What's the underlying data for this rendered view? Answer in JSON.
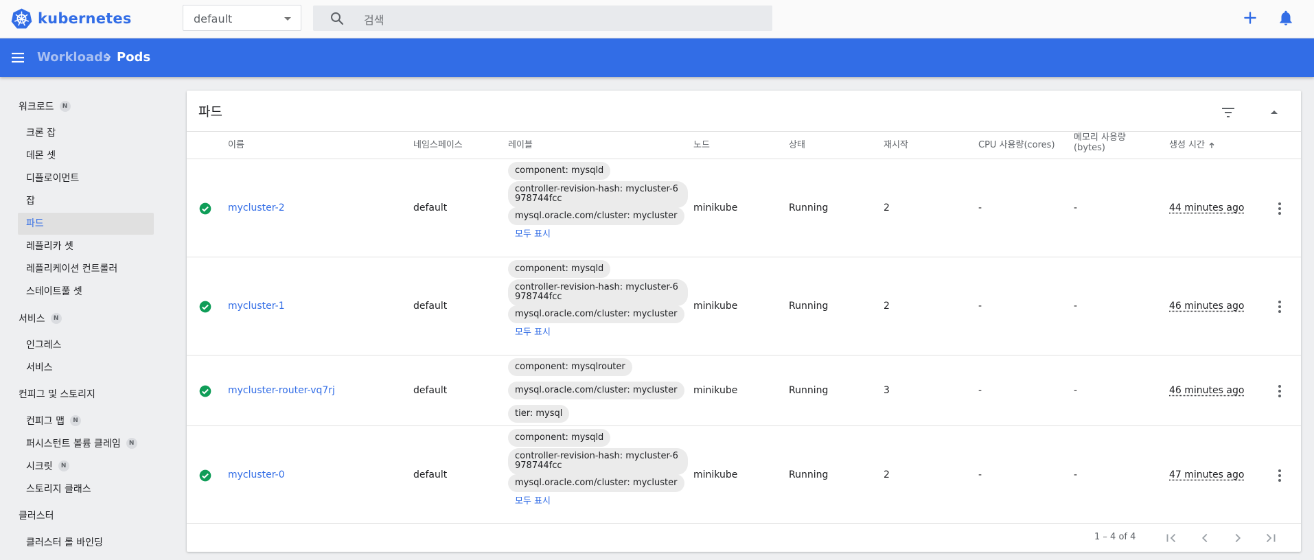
{
  "app": {
    "brand": "kubernetes",
    "accent": "#326de6"
  },
  "topbar": {
    "namespace": "default",
    "search_placeholder": "검색"
  },
  "breadcrumb": {
    "parent": "Workloads",
    "current": "Pods"
  },
  "sidebar": {
    "workloads": {
      "label": "워크로드",
      "badge": "N"
    },
    "workload_items": [
      "크론 잡",
      "데몬 셋",
      "디플로이먼트",
      "잡",
      "파드",
      "레플리카 셋",
      "레플리케이션 컨트롤러",
      "스테이트풀 셋"
    ],
    "services": {
      "label": "서비스",
      "badge": "N"
    },
    "service_items": [
      "인그레스",
      "서비스"
    ],
    "config": {
      "label": "컨피그 및 스토리지"
    },
    "config_items": [
      {
        "label": "컨피그 맵",
        "badge": "N"
      },
      {
        "label": "퍼시스턴트 볼륨 클레임",
        "badge": "N"
      },
      {
        "label": "시크릿",
        "badge": "N"
      },
      {
        "label": "스토리지 클래스"
      }
    ],
    "cluster": {
      "label": "클러스터"
    },
    "cluster_items": [
      "클러스터 롤 바인딩"
    ]
  },
  "card": {
    "title": "파드",
    "columns": {
      "name": "이름",
      "namespace": "네임스페이스",
      "labels": "레이블",
      "node": "노드",
      "status": "상태",
      "restarts": "재시작",
      "cpu": "CPU 사용량(cores)",
      "memory": "메모리 사용량 (bytes)",
      "created": "생성 시간"
    },
    "show_all": "모두 표시",
    "rows": [
      {
        "name": "mycluster-2",
        "namespace": "default",
        "labels": [
          "component: mysqld",
          "controller-revision-hash: mycluster-6978744fcc",
          "mysql.oracle.com/cluster: mycluster"
        ],
        "node": "minikube",
        "status": "Running",
        "restarts": "2",
        "cpu": "-",
        "memory": "-",
        "created": "44 minutes ago"
      },
      {
        "name": "mycluster-1",
        "namespace": "default",
        "labels": [
          "component: mysqld",
          "controller-revision-hash: mycluster-6978744fcc",
          "mysql.oracle.com/cluster: mycluster"
        ],
        "node": "minikube",
        "status": "Running",
        "restarts": "2",
        "cpu": "-",
        "memory": "-",
        "created": "46 minutes ago"
      },
      {
        "name": "mycluster-router-vq7rj",
        "namespace": "default",
        "labels": [
          "component: mysqlrouter",
          "mysql.oracle.com/cluster: mycluster",
          "tier: mysql"
        ],
        "node": "minikube",
        "status": "Running",
        "restarts": "3",
        "cpu": "-",
        "memory": "-",
        "created": "46 minutes ago"
      },
      {
        "name": "mycluster-0",
        "namespace": "default",
        "labels": [
          "component: mysqld",
          "controller-revision-hash: mycluster-6978744fcc",
          "mysql.oracle.com/cluster: mycluster"
        ],
        "node": "minikube",
        "status": "Running",
        "restarts": "2",
        "cpu": "-",
        "memory": "-",
        "created": "47 minutes ago"
      }
    ],
    "pagination": "1 – 4 of 4"
  },
  "colors": {
    "header": "#326de6",
    "status_ok": "#0f9d58"
  },
  "icons": [
    "kubernetes-logo-icon",
    "search-icon",
    "add-icon",
    "bell-icon",
    "menu-icon",
    "chevron-right-icon",
    "filter-icon",
    "collapse-icon",
    "check-circle-icon",
    "more-vert-icon",
    "first-page-icon",
    "prev-page-icon",
    "next-page-icon",
    "last-page-icon"
  ]
}
